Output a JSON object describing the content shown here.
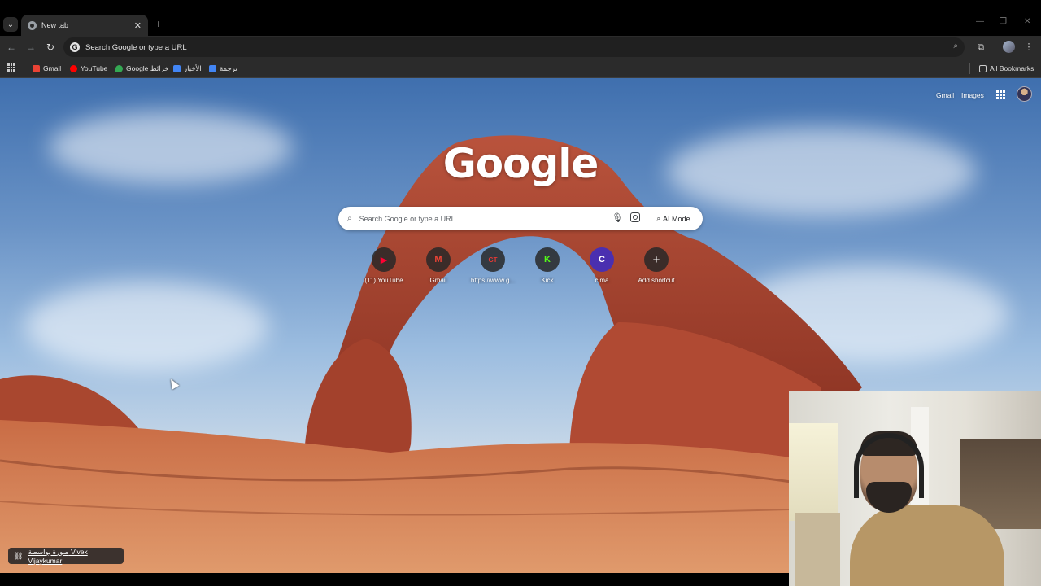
{
  "browser": {
    "tab_search_glyph": "⌄",
    "tab": {
      "title": "New tab",
      "close_glyph": "✕"
    },
    "new_tab_glyph": "+",
    "window_controls": {
      "minimize": "—",
      "restore": "❐",
      "close": "✕"
    },
    "nav": {
      "back": "←",
      "forward": "→",
      "reload": "↻"
    },
    "omnibox": {
      "g_glyph": "G",
      "placeholder": "Search Google or type a URL",
      "zoom_glyph": "⌕"
    },
    "toolbar_icons": {
      "extensions": "⧉",
      "menu": "⋮"
    },
    "bookmarks": [
      {
        "label": "Gmail",
        "color": "#ea4335"
      },
      {
        "label": "YouTube",
        "color": "#ff0000"
      },
      {
        "label": "Google خرائط",
        "color": "#34a853"
      },
      {
        "label": "الأخبار",
        "color": "#4285f4"
      },
      {
        "label": "ترجمة",
        "color": "#4285f4"
      }
    ],
    "all_bookmarks": "All Bookmarks"
  },
  "ntp": {
    "top_links": {
      "gmail": "Gmail",
      "images": "Images"
    },
    "logo_text": "Google",
    "search": {
      "placeholder": "Search Google or type a URL",
      "ai_mode_label": "AI Mode",
      "ai_glyph": "⌕"
    },
    "shortcuts": [
      {
        "label": "(11) YouTube",
        "glyph": "▶",
        "color": "#ff0033"
      },
      {
        "label": "Gmail",
        "glyph": "M",
        "color": "#ea4335"
      },
      {
        "label": "https://www.g...",
        "glyph": "GT",
        "color": "#e53935"
      },
      {
        "label": "Kick",
        "glyph": "K",
        "color": "#53fc18"
      },
      {
        "label": "cima",
        "glyph": "C",
        "color": "#7c4dff"
      },
      {
        "label": "Add shortcut",
        "glyph": "+",
        "color": "#ffffff"
      }
    ],
    "attribution": {
      "link_glyph": "⛓",
      "text": "صورة بواسطة Vivek Vijaykumar"
    }
  }
}
